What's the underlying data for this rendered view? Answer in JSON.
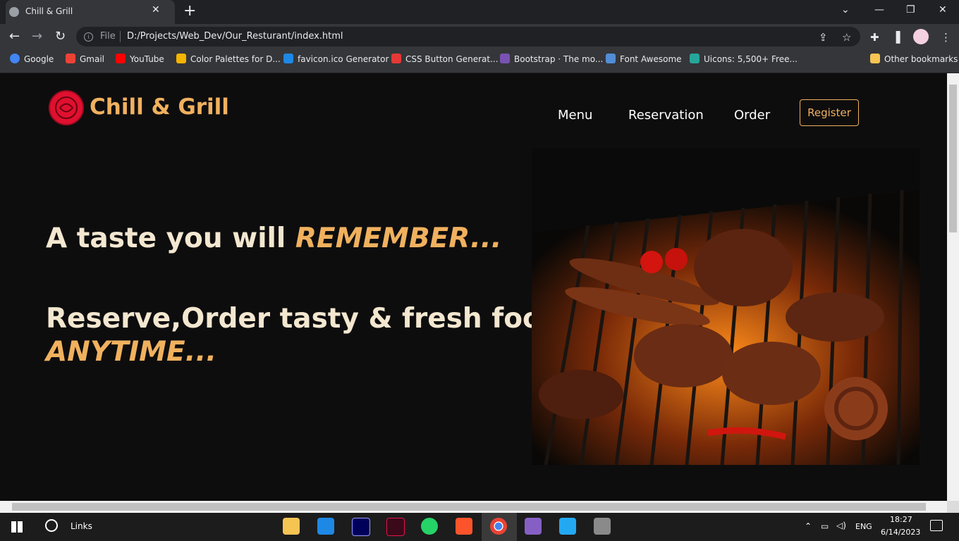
{
  "browser": {
    "tab_title": "Chill & Grill",
    "file_label": "File",
    "url": "D:/Projects/Web_Dev/Our_Resturant/index.html",
    "bookmarks": [
      {
        "label": "Google",
        "color": "#4285f4"
      },
      {
        "label": "Gmail",
        "color": "#ea4335"
      },
      {
        "label": "YouTube",
        "color": "#ff0000"
      },
      {
        "label": "Color Palettes for D...",
        "color": "#f4b400"
      },
      {
        "label": "favicon.ico Generator",
        "color": "#1e88e5"
      },
      {
        "label": "CSS Button Generat...",
        "color": "#e53935"
      },
      {
        "label": "Bootstrap · The mo...",
        "color": "#7952b3"
      },
      {
        "label": "Font Awesome",
        "color": "#528dd7"
      },
      {
        "label": "Uicons: 5,500+ Free...",
        "color": "#26a69a"
      }
    ],
    "other_bookmarks": "Other bookmarks"
  },
  "site": {
    "brand": "Chill & Grill",
    "nav": [
      "Menu",
      "Reservation",
      "Order"
    ],
    "register": "Register",
    "hero_line1_prefix": "A taste you will ",
    "hero_line1_accent": "REMEMBER...",
    "hero_line2": "Reserve,Order tasty & fresh food",
    "hero_line3": "ANYTIME...",
    "accent_color": "#f0b15e"
  },
  "taskbar": {
    "search_label": "Links",
    "language": "ENG",
    "time": "18:27",
    "date": "6/14/2023"
  }
}
